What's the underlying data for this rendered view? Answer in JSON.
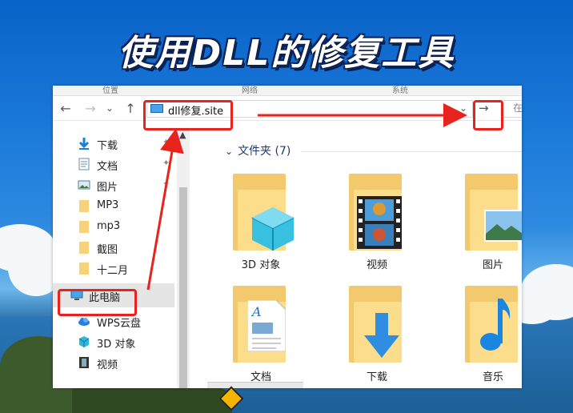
{
  "banner": {
    "title": "使用DLL的修复工具"
  },
  "ribbon": {
    "tabs": [
      "位置",
      "网络",
      "系统"
    ]
  },
  "nav": {
    "back": "←",
    "forward": "→",
    "recent": "⌄",
    "up": "↑"
  },
  "address": {
    "value": "dll修复.site",
    "dropdown": "⌄",
    "go": "→",
    "search_placeholder": "在"
  },
  "sidebar": {
    "items": [
      {
        "label": "下载",
        "icon": "download-arrow-icon",
        "pin": "📌"
      },
      {
        "label": "文档",
        "icon": "document-icon",
        "pin": "📌"
      },
      {
        "label": "图片",
        "icon": "picture-icon",
        "pin": "📌"
      },
      {
        "label": "MP3",
        "icon": "folder-icon"
      },
      {
        "label": "mp3",
        "icon": "folder-icon"
      },
      {
        "label": "截图",
        "icon": "folder-icon"
      },
      {
        "label": "十二月",
        "icon": "folder-icon"
      },
      {
        "label": "此电脑",
        "icon": "computer-icon"
      },
      {
        "label": "WPS云盘",
        "icon": "cloud-icon"
      },
      {
        "label": "3D 对象",
        "icon": "cube-icon"
      },
      {
        "label": "视频",
        "icon": "film-icon"
      }
    ]
  },
  "content": {
    "group_header": "文件夹 (7)",
    "folders": [
      {
        "label": "3D 对象",
        "icon": "cube-icon"
      },
      {
        "label": "视频",
        "icon": "film-icon"
      },
      {
        "label": "图片",
        "icon": "picture-icon"
      },
      {
        "label": "文档",
        "icon": "document-icon"
      },
      {
        "label": "下载",
        "icon": "download-arrow-icon"
      },
      {
        "label": "音乐",
        "icon": "music-note-icon"
      }
    ]
  },
  "colors": {
    "highlight": "#e8231d",
    "folder": "#f2c96c",
    "accent": "#1b7fd8"
  }
}
